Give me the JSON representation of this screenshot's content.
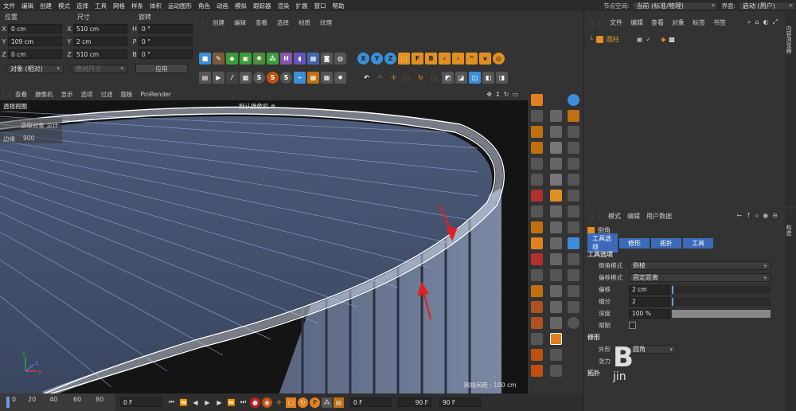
{
  "menubar": {
    "items": [
      "文件",
      "编辑",
      "创建",
      "模式",
      "选择",
      "工具",
      "网格",
      "样条",
      "体积",
      "运动图形",
      "角色",
      "动画",
      "模拟",
      "跟踪器",
      "渲染",
      "扩展",
      "窗口",
      "帮助"
    ],
    "node_space_label": "节点空间:",
    "node_space_value": "当前 (标准/物理)",
    "layout_label": "界面:",
    "layout_value": "启动 (用户)"
  },
  "coord": {
    "headers": [
      "位置",
      "尺寸",
      "旋转"
    ],
    "rows": [
      {
        "axis": "X",
        "pos": "0 cm",
        "sz_axis": "X",
        "size": "510 cm",
        "rot_axis": "H",
        "rot": "0 °"
      },
      {
        "axis": "Y",
        "pos": "109 cm",
        "sz_axis": "Y",
        "size": "2 cm",
        "rot_axis": "P",
        "rot": "0 °"
      },
      {
        "axis": "Z",
        "pos": "0 cm",
        "sz_axis": "Z",
        "size": "510 cm",
        "rot_axis": "B",
        "rot": "0 °"
      }
    ],
    "mode_value": "对象 (相对)",
    "size_mode_value": "绝对尺寸",
    "apply_label": "应用"
  },
  "toolbar_top": [
    "创建",
    "编辑",
    "查看",
    "选择",
    "材质",
    "纹理"
  ],
  "viewport": {
    "menu": [
      "查看",
      "摄像机",
      "显示",
      "选项",
      "过滤",
      "面板",
      "ProRender"
    ],
    "tab": "透视视图",
    "camera": "默认摄像机",
    "stats_title": "选取对象 总计",
    "stats_label": "边缘",
    "stats_value": "900",
    "grid_info": "网格间距 : 100 cm"
  },
  "objects": {
    "menu": [
      "文件",
      "编辑",
      "查看",
      "对象",
      "标签",
      "书签"
    ],
    "item_name": "圆柱",
    "side_tabs": [
      "对象",
      "场次",
      "内容浏览器"
    ]
  },
  "attrs": {
    "menu": [
      "模式",
      "编辑",
      "用户数据"
    ],
    "title": "倒角",
    "tabs": [
      "工具选项",
      "修形",
      "拓扑",
      "工具"
    ],
    "section": "工具选项",
    "bevel_mode_label": "倒角模式",
    "bevel_mode_value": "倒棱",
    "offset_mode_label": "偏移模式",
    "offset_mode_value": "固定距离",
    "offset_label": "偏移",
    "offset_value": "2 cm",
    "subdiv_label": "细分",
    "subdiv_value": "2",
    "depth_label": "深度",
    "depth_value": "100 %",
    "depth_fill": 1.0,
    "limit_label": "限制",
    "shaping_section": "修形",
    "shape_label": "外形",
    "shape_value": "圆角",
    "tension_label": "张力",
    "topology_section": "拓扑",
    "side_tabs": [
      "属性",
      "层",
      "构造"
    ]
  },
  "timeline": {
    "ticks": [
      "0",
      "20",
      "40",
      "60",
      "80"
    ],
    "current_frame": "0 F",
    "start_frame": "0 F",
    "end_frame": "90 F",
    "end_frame2": "90 F"
  },
  "watermark": "Baidu jing yan"
}
